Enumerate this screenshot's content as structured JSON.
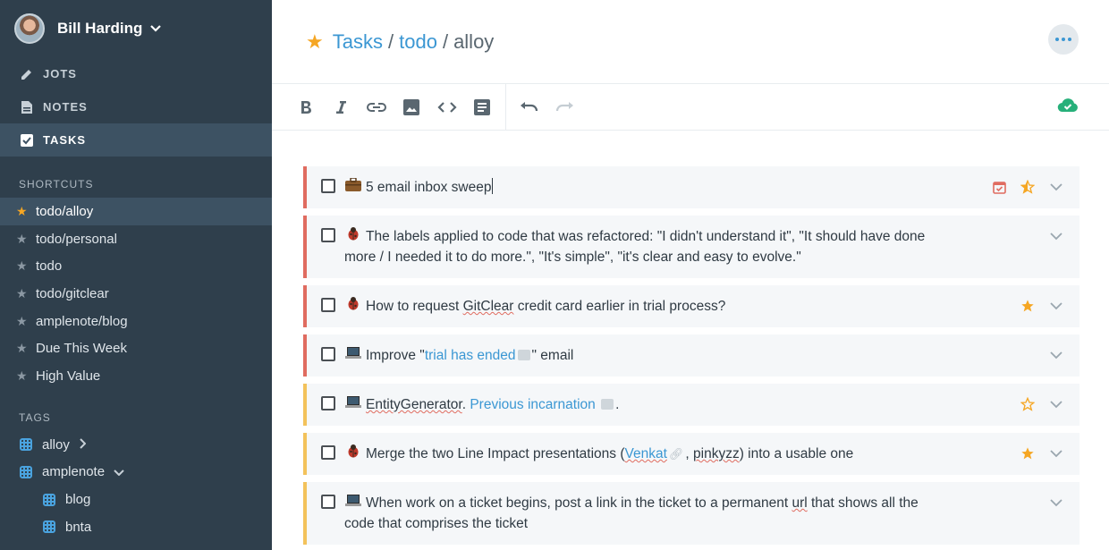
{
  "user": {
    "name": "Bill Harding"
  },
  "nav": [
    {
      "label": "JOTS",
      "icon": "pencil-icon"
    },
    {
      "label": "NOTES",
      "icon": "document-icon"
    },
    {
      "label": "TASKS",
      "icon": "checkbox-icon",
      "active": true
    }
  ],
  "shortcuts": {
    "title": "SHORTCUTS",
    "items": [
      "todo/alloy",
      "todo/personal",
      "todo",
      "todo/gitclear",
      "amplenote/blog",
      "Due This Week",
      "High Value"
    ]
  },
  "tags": {
    "title": "TAGS",
    "items": [
      "alloy",
      "amplenote",
      "blog",
      "bnta"
    ]
  },
  "breadcrumb": {
    "root": "Tasks",
    "sep": "/",
    "parent": "todo",
    "current": "alloy"
  },
  "toolbar": [
    "bold-icon",
    "italic-icon",
    "link-icon",
    "image-icon",
    "code-icon",
    "note-icon",
    "undo-icon",
    "redo-icon"
  ],
  "tasks": [
    {
      "emoji": "briefcase-icon",
      "text": "5 email inbox sweep"
    },
    {
      "emoji": "bug-icon",
      "line1": "The labels applied to code that was refactored: \"I didn't understand it\", \"It should have done",
      "line2": "more / I needed it to do more.\", \"It's simple\", \"it's clear and easy to evolve.\""
    },
    {
      "emoji": "bug-icon",
      "pre": "How to request ",
      "squig": "GitClear",
      "post": " credit card earlier in trial process?"
    },
    {
      "emoji": "laptop-icon",
      "pre": "Improve \"",
      "link": "trial has ended",
      "post": "\" email"
    },
    {
      "emoji": "laptop-icon",
      "squig": "EntityGenerator",
      "mid": ". ",
      "link": "Previous incarnation",
      "post": "."
    },
    {
      "emoji": "bug-icon",
      "pre": "Merge the two Line Impact presentations (",
      "link": "Venkat",
      "mid": ", ",
      "squig": "pinkyzz",
      "post": ") into a usable one"
    },
    {
      "emoji": "laptop-icon",
      "line1pre": "When work on a ticket begins, post a link in the ticket to a permanent ",
      "line1squig": "url",
      "line1post": " that shows all the",
      "line2": "code that comprises the ticket"
    }
  ],
  "colors": {
    "sidebar": "#2f3f4c",
    "accent": "#3b97d3",
    "star": "#f5a623",
    "red_border": "#e06c60",
    "yellow_border": "#f3c25b",
    "sync": "#27b07a"
  }
}
